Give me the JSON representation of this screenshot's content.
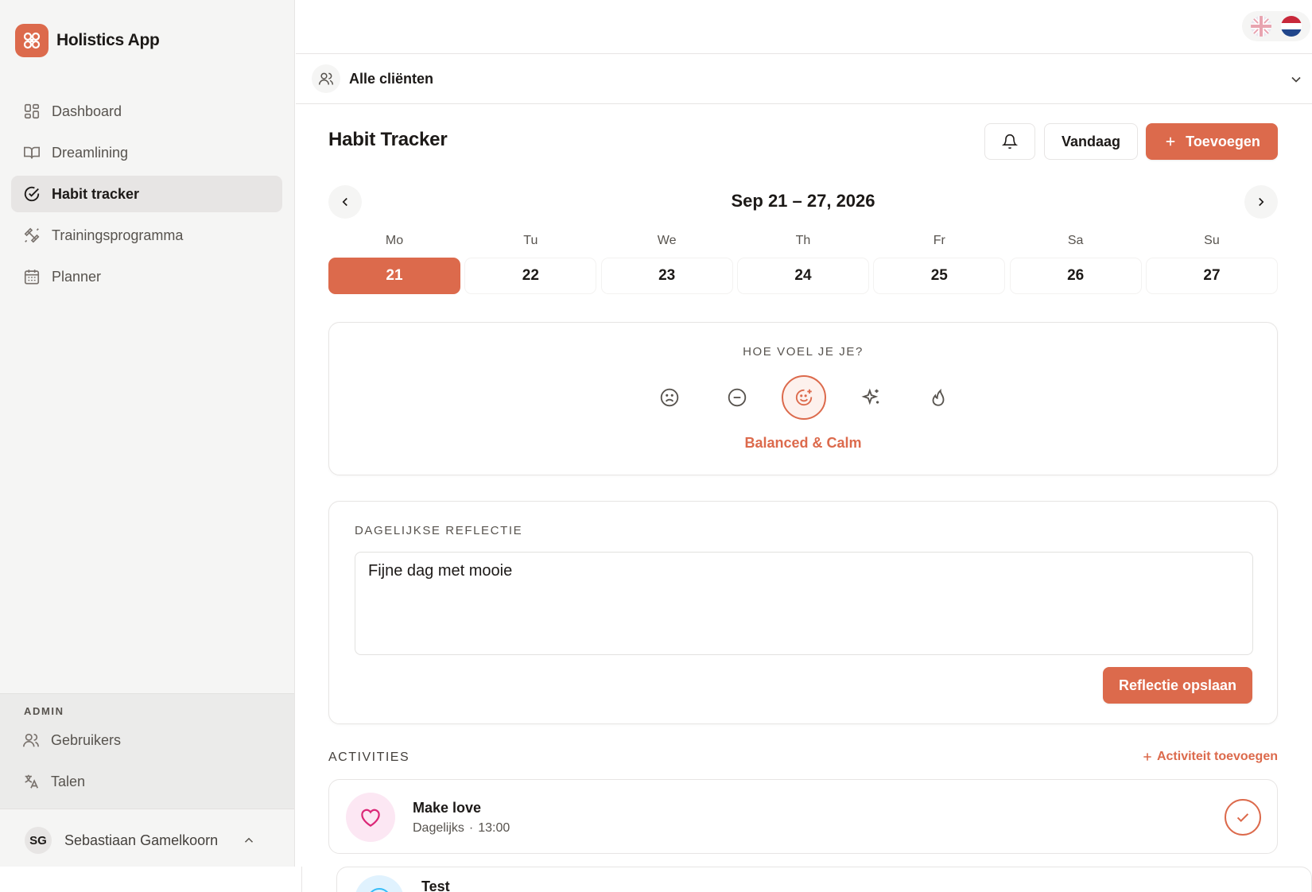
{
  "app": {
    "title": "Holistics App",
    "accent": "#dc6a4c"
  },
  "sidebar": {
    "items": [
      {
        "label": "Dashboard",
        "icon": "dashboard-icon"
      },
      {
        "label": "Dreamlining",
        "icon": "book-icon"
      },
      {
        "label": "Habit tracker",
        "icon": "circle-check-icon",
        "active": true
      },
      {
        "label": "Trainingsprogramma",
        "icon": "dumbbell-icon"
      },
      {
        "label": "Planner",
        "icon": "calendar-icon"
      }
    ],
    "admin": {
      "title": "ADMIN",
      "items": [
        {
          "label": "Gebruikers",
          "icon": "users-icon"
        },
        {
          "label": "Talen",
          "icon": "translate-icon"
        }
      ]
    },
    "user": {
      "initials": "SG",
      "name": "Sebastiaan Gamelkoorn"
    }
  },
  "topbar": {
    "languages": [
      "English",
      "Nederlands"
    ]
  },
  "client_selector": {
    "label": "Alle cliënten"
  },
  "header": {
    "title": "Habit Tracker",
    "today_label": "Vandaag",
    "add_label": "Toevoegen"
  },
  "week": {
    "range": "Sep 21 – 27, 2026",
    "days": [
      {
        "abbr": "Mo",
        "num": "21",
        "selected": true
      },
      {
        "abbr": "Tu",
        "num": "22"
      },
      {
        "abbr": "We",
        "num": "23"
      },
      {
        "abbr": "Th",
        "num": "24"
      },
      {
        "abbr": "Fr",
        "num": "25"
      },
      {
        "abbr": "Sa",
        "num": "26"
      },
      {
        "abbr": "Su",
        "num": "27"
      }
    ]
  },
  "mood": {
    "title": "HOE VOEL JE JE?",
    "options": [
      "sad-face-icon",
      "neutral-face-icon",
      "smile-sparkle-icon",
      "sparkles-icon",
      "flame-icon"
    ],
    "selected_index": 2,
    "selected_label": "Balanced & Calm"
  },
  "reflection": {
    "title": "DAGELIJKSE REFLECTIE",
    "value": "Fijne dag met mooie",
    "save_label": "Reflectie opslaan"
  },
  "activities": {
    "title": "ACTIVITIES",
    "add_label": "Activiteit toevoegen",
    "items": [
      {
        "name": "Make love",
        "frequency": "Dagelijks",
        "separator": "·",
        "time": "13:00",
        "icon": "heart-icon",
        "icon_bg": "#fce7f3",
        "icon_color": "#db2777",
        "done": true
      },
      {
        "name": "Test",
        "icon": "clock-icon",
        "icon_bg": "#e0f2fe"
      }
    ]
  }
}
